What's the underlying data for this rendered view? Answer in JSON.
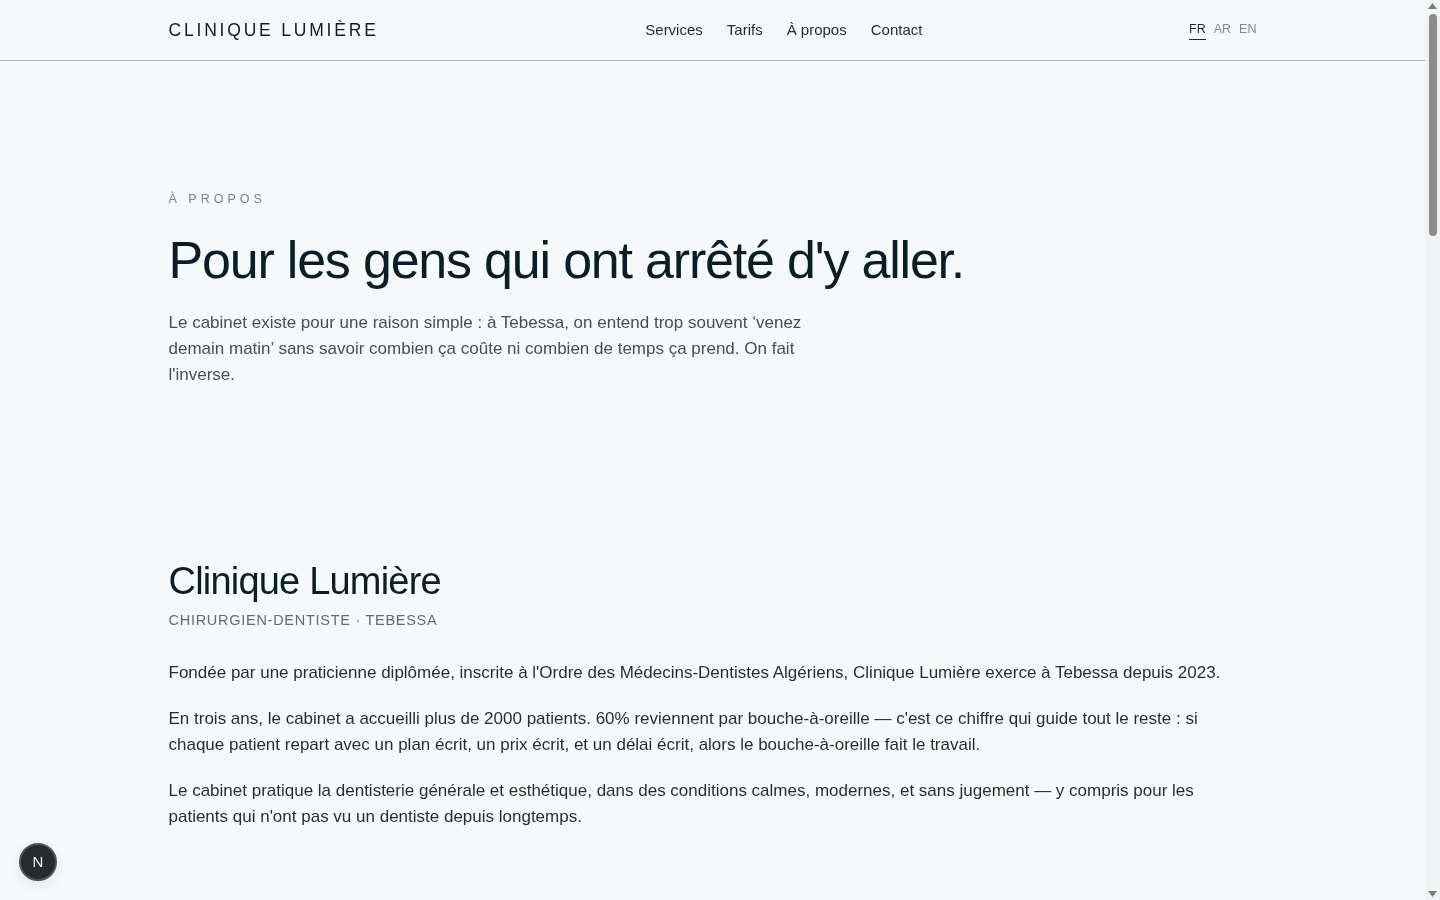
{
  "header": {
    "brand": "CLINIQUE LUMIÈRE",
    "nav": [
      {
        "label": "Services"
      },
      {
        "label": "Tarifs"
      },
      {
        "label": "À propos"
      },
      {
        "label": "Contact"
      }
    ],
    "languages": [
      {
        "label": "FR",
        "selected": true
      },
      {
        "label": "AR",
        "selected": false
      },
      {
        "label": "EN",
        "selected": false
      }
    ]
  },
  "hero": {
    "eyebrow": "À PROPOS",
    "title": "Pour les gens qui ont arrêté d'y aller.",
    "intro": "Le cabinet existe pour une raison simple : à Tebessa, on entend trop souvent ‘venez demain matin’ sans savoir combien ça coûte ni combien de temps ça prend. On fait l'inverse."
  },
  "about": {
    "title": "Clinique Lumière",
    "subtitle": "CHIRURGIEN-DENTISTE · TEBESSA",
    "paragraphs": [
      "Fondée par une praticienne diplômée, inscrite à l'Ordre des Médecins-Dentistes Algériens, Clinique Lumière exerce à Tebessa depuis 2023.",
      "En trois ans, le cabinet a accueilli plus de 2000 patients. 60% reviennent par bouche-à-oreille — c'est ce chiffre qui guide tout le reste : si chaque patient repart avec un plan écrit, un prix écrit, et un délai écrit, alors le bouche-à-oreille fait le travail.",
      "Le cabinet pratique la dentisterie générale et esthétique, dans des conditions calmes, modernes, et sans jugement — y compris pour les patients qui n'ont pas vu un dentiste depuis longtemps."
    ]
  },
  "dev_badge": {
    "label": "N"
  }
}
